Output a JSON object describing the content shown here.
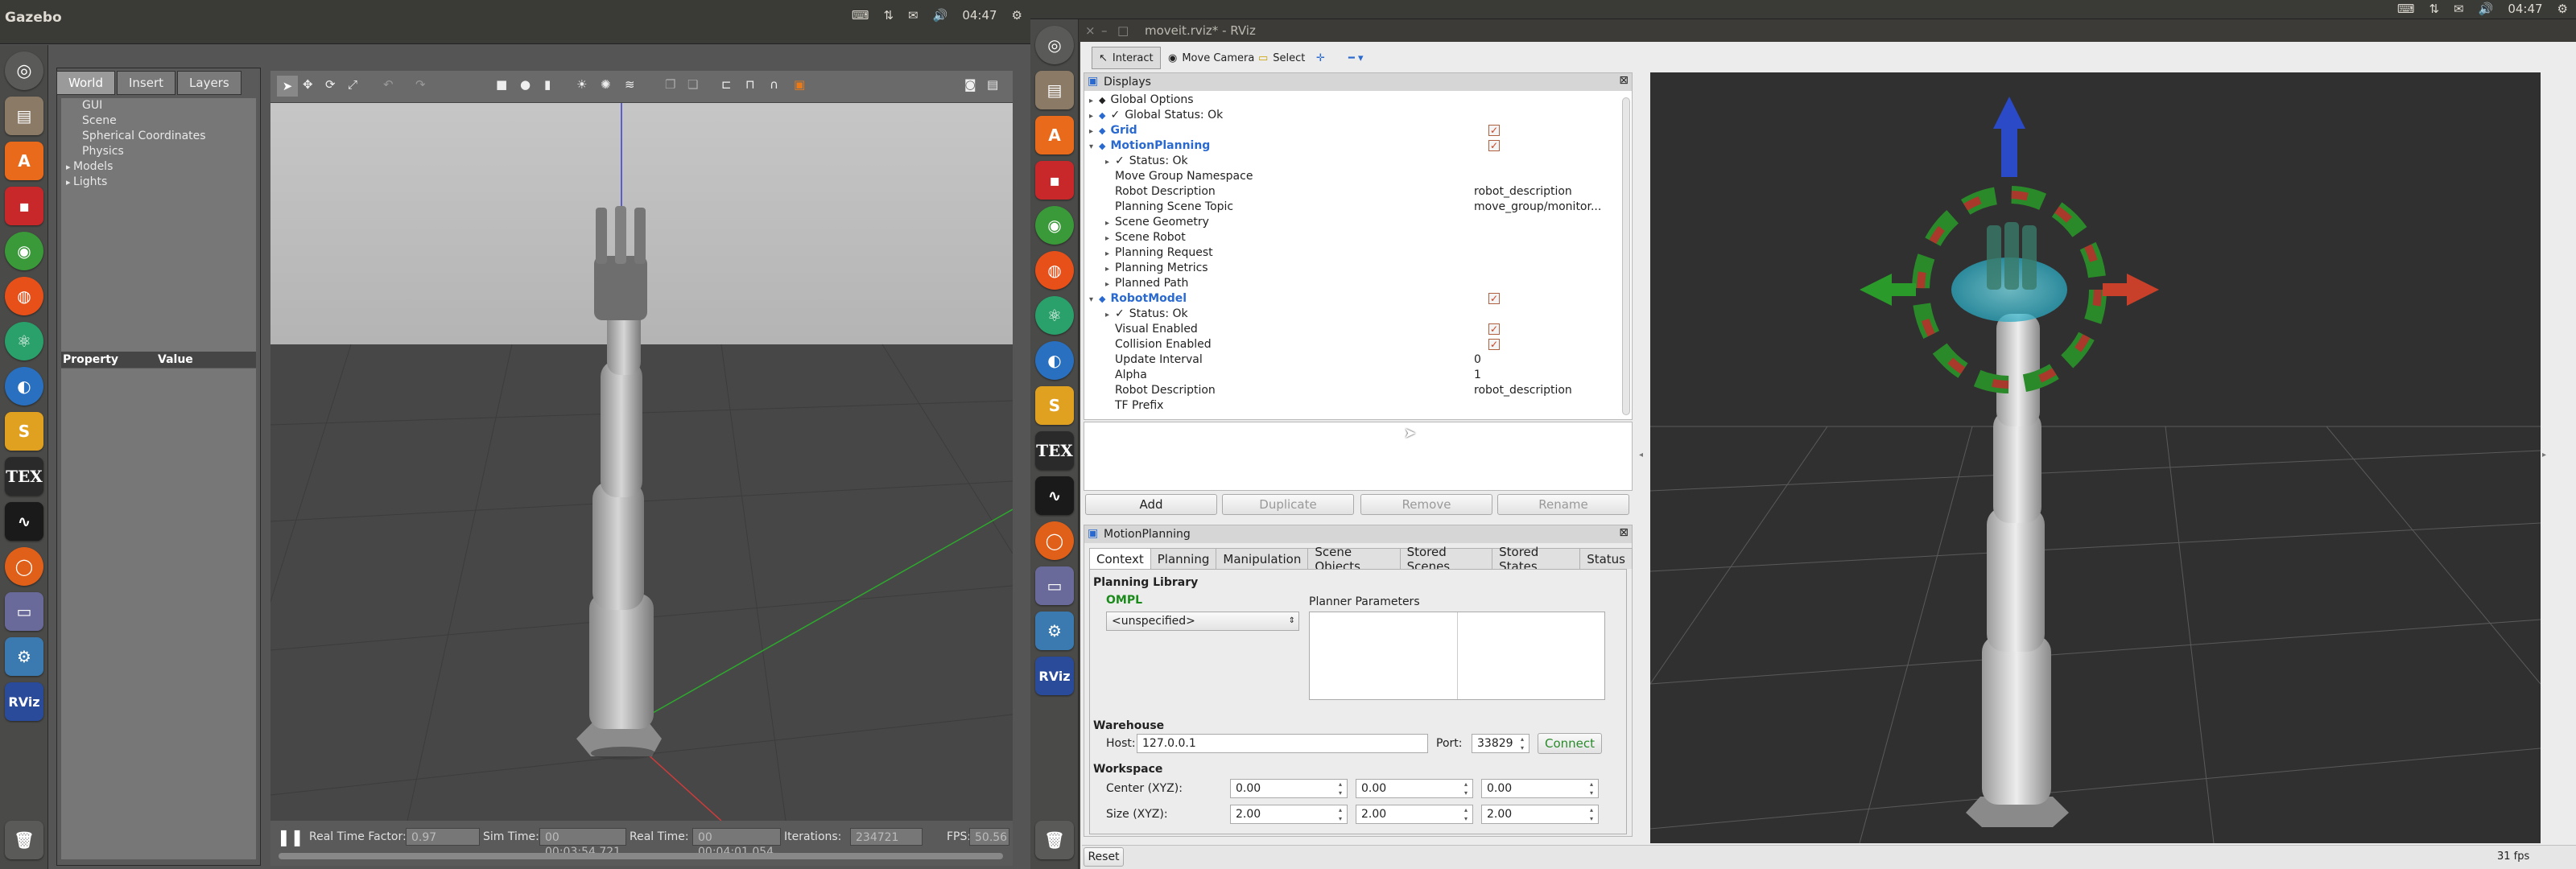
{
  "left_screen": {
    "topbar": {
      "title": "Gazebo",
      "time": "04:47"
    },
    "world_tabs": [
      "World",
      "Insert",
      "Layers"
    ],
    "world_tree": [
      {
        "label": "GUI",
        "expandable": false
      },
      {
        "label": "Scene",
        "expandable": false
      },
      {
        "label": "Spherical Coordinates",
        "expandable": false
      },
      {
        "label": "Physics",
        "expandable": false
      },
      {
        "label": "Models",
        "expandable": true
      },
      {
        "label": "Lights",
        "expandable": true
      }
    ],
    "property_header": {
      "property": "Property",
      "value": "Value"
    },
    "bottom": {
      "real_time_factor_label": "Real Time Factor:",
      "real_time_factor": "0.97",
      "sim_time_label": "Sim Time:",
      "sim_time": "00 00:03:54.721",
      "real_time_label": "Real Time:",
      "real_time": "00 00:04:01.054",
      "iterations_label": "Iterations:",
      "iterations": "234721",
      "fps_label": "FPS:",
      "fps": "50.56"
    }
  },
  "right_screen": {
    "topbar": {
      "time": "04:47"
    },
    "window_title": "moveit.rviz* - RViz",
    "toolbar": {
      "interact": "Interact",
      "move_camera": "Move Camera",
      "select": "Select"
    },
    "displays": {
      "title": "Displays",
      "rows": [
        {
          "label": "Global Options",
          "indent": 0,
          "arrow": "▸",
          "value": "",
          "check": false,
          "bold": false,
          "color": "#222"
        },
        {
          "label": "Global Status: Ok",
          "indent": 0,
          "arrow": "▸",
          "value": "",
          "check": false,
          "bold": false,
          "color": "#222",
          "prefix": "✓"
        },
        {
          "label": "Grid",
          "indent": 0,
          "arrow": "▸",
          "value": "",
          "check": true,
          "bold": true,
          "color": "#2a6ad0"
        },
        {
          "label": "MotionPlanning",
          "indent": 0,
          "arrow": "▾",
          "value": "",
          "check": true,
          "bold": true,
          "color": "#2a6ad0"
        },
        {
          "label": "Status: Ok",
          "indent": 1,
          "arrow": "▸",
          "value": "",
          "check": false,
          "bold": false,
          "color": "#222",
          "prefix": "✓"
        },
        {
          "label": "Move Group Namespace",
          "indent": 1,
          "arrow": "",
          "value": "",
          "check": false,
          "bold": false,
          "color": "#222"
        },
        {
          "label": "Robot Description",
          "indent": 1,
          "arrow": "",
          "value": "robot_description",
          "check": false,
          "bold": false,
          "color": "#222"
        },
        {
          "label": "Planning Scene Topic",
          "indent": 1,
          "arrow": "",
          "value": "move_group/monitor...",
          "check": false,
          "bold": false,
          "color": "#222"
        },
        {
          "label": "Scene Geometry",
          "indent": 1,
          "arrow": "▸",
          "value": "",
          "check": false,
          "bold": false,
          "color": "#222"
        },
        {
          "label": "Scene Robot",
          "indent": 1,
          "arrow": "▸",
          "value": "",
          "check": false,
          "bold": false,
          "color": "#222"
        },
        {
          "label": "Planning Request",
          "indent": 1,
          "arrow": "▸",
          "value": "",
          "check": false,
          "bold": false,
          "color": "#222"
        },
        {
          "label": "Planning Metrics",
          "indent": 1,
          "arrow": "▸",
          "value": "",
          "check": false,
          "bold": false,
          "color": "#222"
        },
        {
          "label": "Planned Path",
          "indent": 1,
          "arrow": "▸",
          "value": "",
          "check": false,
          "bold": false,
          "color": "#222"
        },
        {
          "label": "RobotModel",
          "indent": 0,
          "arrow": "▾",
          "value": "",
          "check": true,
          "bold": true,
          "color": "#2a6ad0"
        },
        {
          "label": "Status: Ok",
          "indent": 1,
          "arrow": "▸",
          "value": "",
          "check": false,
          "bold": false,
          "color": "#222",
          "prefix": "✓"
        },
        {
          "label": "Visual Enabled",
          "indent": 1,
          "arrow": "",
          "value": "",
          "check": true,
          "bold": false,
          "color": "#222"
        },
        {
          "label": "Collision Enabled",
          "indent": 1,
          "arrow": "",
          "value": "",
          "check": true,
          "bold": false,
          "color": "#222"
        },
        {
          "label": "Update Interval",
          "indent": 1,
          "arrow": "",
          "value": "0",
          "check": false,
          "bold": false,
          "color": "#222"
        },
        {
          "label": "Alpha",
          "indent": 1,
          "arrow": "",
          "value": "1",
          "check": false,
          "bold": false,
          "color": "#222"
        },
        {
          "label": "Robot Description",
          "indent": 1,
          "arrow": "",
          "value": "robot_description",
          "check": false,
          "bold": false,
          "color": "#222"
        },
        {
          "label": "TF Prefix",
          "indent": 1,
          "arrow": "",
          "value": "",
          "check": false,
          "bold": false,
          "color": "#222"
        }
      ],
      "buttons": {
        "add": "Add",
        "duplicate": "Duplicate",
        "remove": "Remove",
        "rename": "Rename"
      }
    },
    "motion_planning": {
      "title": "MotionPlanning",
      "tabs": [
        "Context",
        "Planning",
        "Manipulation",
        "Scene Objects",
        "Stored Scenes",
        "Stored States",
        "Status"
      ],
      "planning_library_label": "Planning Library",
      "library": "OMPL",
      "planner_select": "<unspecified>",
      "planner_params_label": "Planner Parameters",
      "warehouse_label": "Warehouse",
      "host_label": "Host:",
      "host": "127.0.0.1",
      "port_label": "Port:",
      "port": "33829",
      "connect": "Connect",
      "workspace_label": "Workspace",
      "center_label": "Center (XYZ):",
      "center": [
        "0.00",
        "0.00",
        "0.00"
      ],
      "size_label": "Size (XYZ):",
      "size": [
        "2.00",
        "2.00",
        "2.00"
      ]
    },
    "status": {
      "reset": "Reset",
      "fps": "31 fps"
    },
    "colors": {
      "accent_blue": "#2a6ad0",
      "omp_green": "#1a8a1a",
      "connect_green": "#2a8a2a"
    }
  }
}
